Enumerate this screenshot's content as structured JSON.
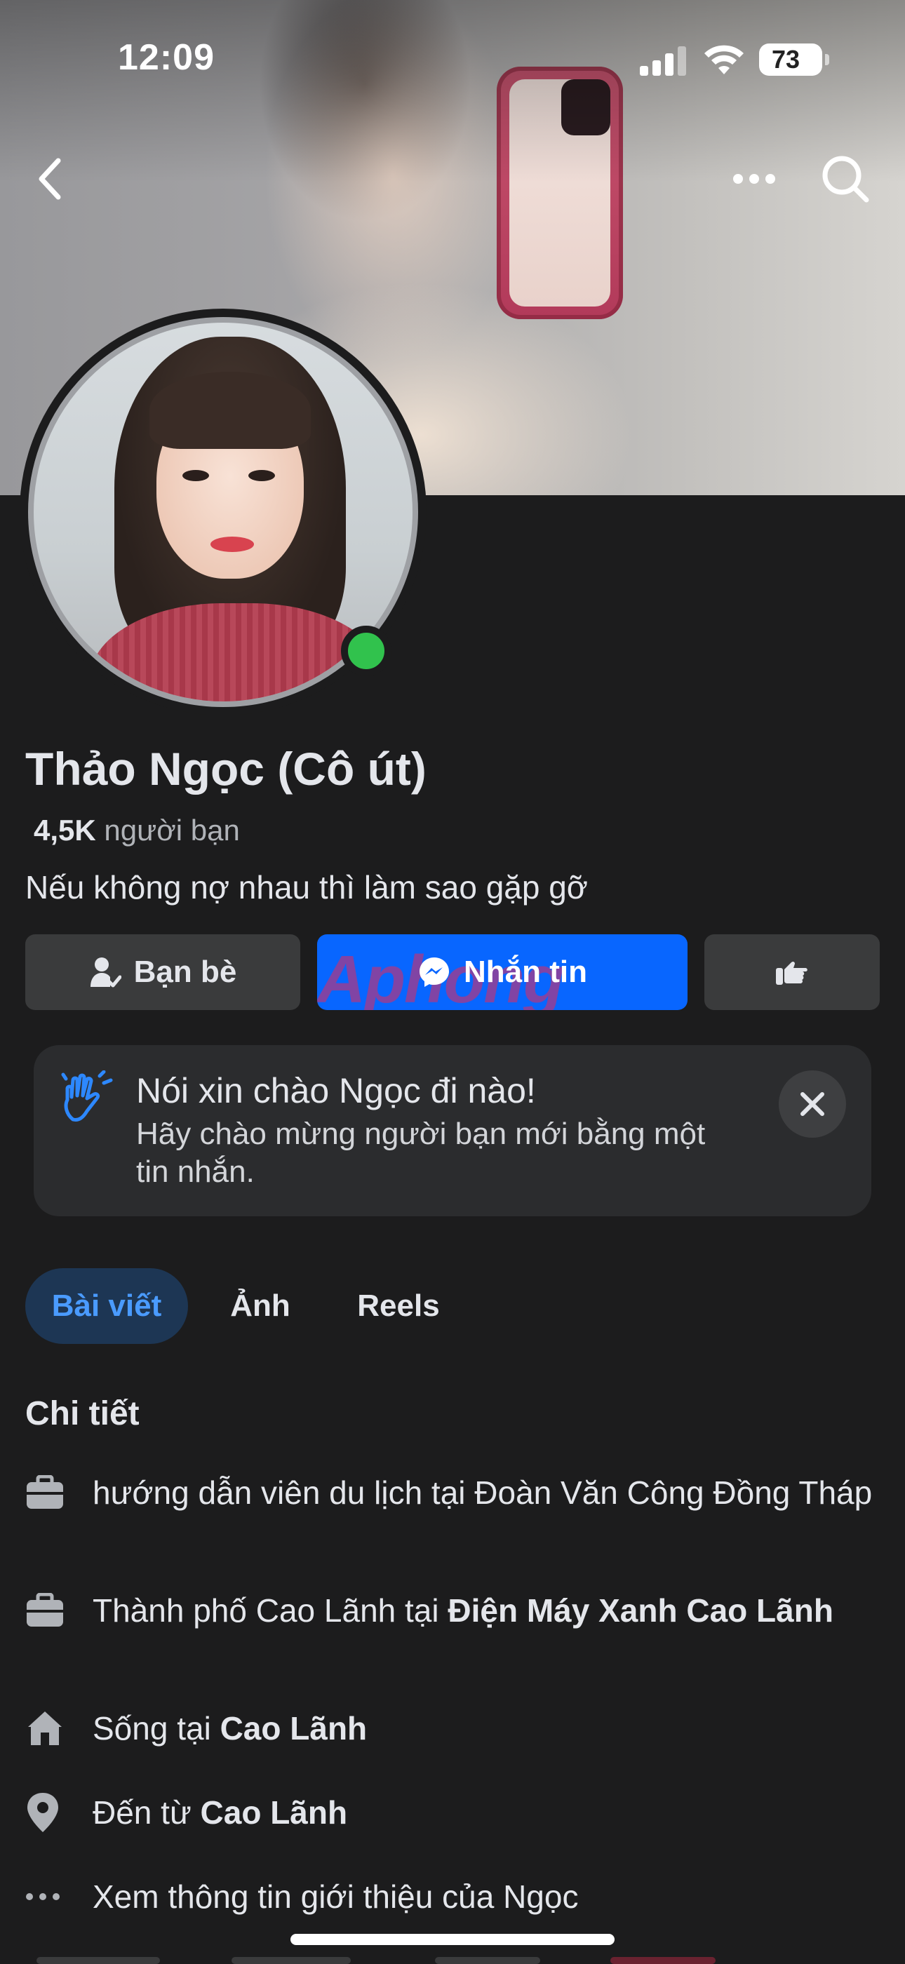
{
  "status_bar": {
    "time": "12:09",
    "battery": "73"
  },
  "top_nav": {
    "back_icon": "chevron-left-icon",
    "more_icon": "ellipsis-icon",
    "search_icon": "search-icon"
  },
  "profile": {
    "name": "Thảo Ngọc (Cô út)",
    "friends_count": "4,5K",
    "friends_label": "người bạn",
    "bio": "Nếu không nợ nhau thì làm sao gặp gỡ",
    "online": true
  },
  "actions": {
    "friends_label": "Bạn bè",
    "message_label": "Nhắn tin",
    "watermark": "Aphong"
  },
  "greeting": {
    "title": "Nói xin chào Ngọc đi nào!",
    "subtitle": "Hãy chào mừng người bạn mới bằng một tin nhắn."
  },
  "tabs": [
    {
      "label": "Bài viết",
      "active": true
    },
    {
      "label": "Ảnh",
      "active": false
    },
    {
      "label": "Reels",
      "active": false
    }
  ],
  "details": {
    "title": "Chi tiết",
    "work1": {
      "text": "hướng dẫn viên du lịch tại Đoàn Văn Công Đồng Tháp"
    },
    "work2": {
      "prefix": "Thành phố Cao Lãnh tại ",
      "bold": "Điện Máy Xanh Cao Lãnh"
    },
    "lives": {
      "prefix": "Sống tại ",
      "bold": "Cao Lãnh"
    },
    "from": {
      "prefix": "Đến từ ",
      "bold": "Cao Lãnh"
    },
    "more": {
      "text": "Xem thông tin giới thiệu của Ngọc"
    }
  },
  "colors": {
    "accent": "#0866ff",
    "online": "#31c24d",
    "background": "#1c1c1d",
    "card": "#2b2c2e"
  }
}
